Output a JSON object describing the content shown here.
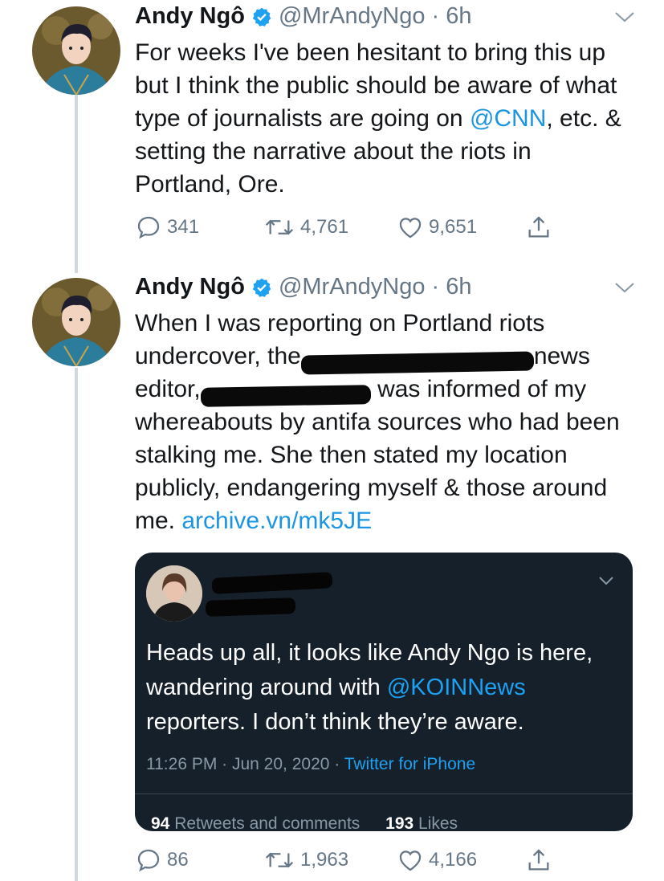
{
  "tweets": [
    {
      "author_name": "Andy Ngô",
      "handle_time": "@MrAndyNgo · 6h",
      "text_parts": {
        "a": "For weeks I've been hesitant to bring this up but I think the public should be aware of what type of journalists are going on ",
        "mention": "@CNN",
        "b": ", etc. & setting the narrative about the riots in Portland, Ore."
      },
      "replies": "341",
      "retweets": "4,761",
      "likes": "9,651"
    },
    {
      "author_name": "Andy Ngô",
      "handle_time": "@MrAndyNgo · 6h",
      "text_parts": {
        "a": "When I was reporting on Portland riots undercover, the",
        "b": "news editor,",
        "c": " was informed of my whereabouts by antifa sources who had been stalking me. She then stated my location publicly, endangering myself & those around me. ",
        "link": "archive.vn/mk5JE"
      },
      "replies": "86",
      "retweets": "1,963",
      "likes": "4,166"
    }
  ],
  "embed": {
    "text_a": "Heads up all, it looks like Andy Ngo is here, wandering around with ",
    "mention": "@KOINNews",
    "text_b": " reporters. I don’t think they’re aware.",
    "timestamp": "11:26 PM · Jun 20, 2020 · ",
    "source": "Twitter for iPhone",
    "retweets_count": "94",
    "retweets_label": " Retweets and comments",
    "likes_count": "193",
    "likes_label": " Likes"
  },
  "icons": {
    "verified": "verified-badge-icon",
    "reply": "reply-icon",
    "retweet": "retweet-icon",
    "like": "heart-icon",
    "share": "share-icon",
    "more": "chevron-down-icon"
  },
  "colors": {
    "link": "#1b95e0",
    "secondary": "#657786",
    "embed_bg": "#15202b"
  }
}
